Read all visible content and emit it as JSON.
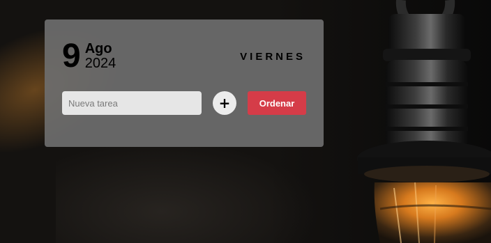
{
  "date": {
    "day": "9",
    "month": "Ago",
    "year": "2024",
    "weekday": "VIERNES"
  },
  "task": {
    "placeholder": "Nueva tarea",
    "value": ""
  },
  "actions": {
    "add_label": "+",
    "sort_label": "Ordenar"
  },
  "colors": {
    "accent": "#d53c48",
    "card_background": "#6e6e6e",
    "input_background": "#e6e6e6"
  },
  "background": {
    "icon": "light-bulb-photo"
  }
}
